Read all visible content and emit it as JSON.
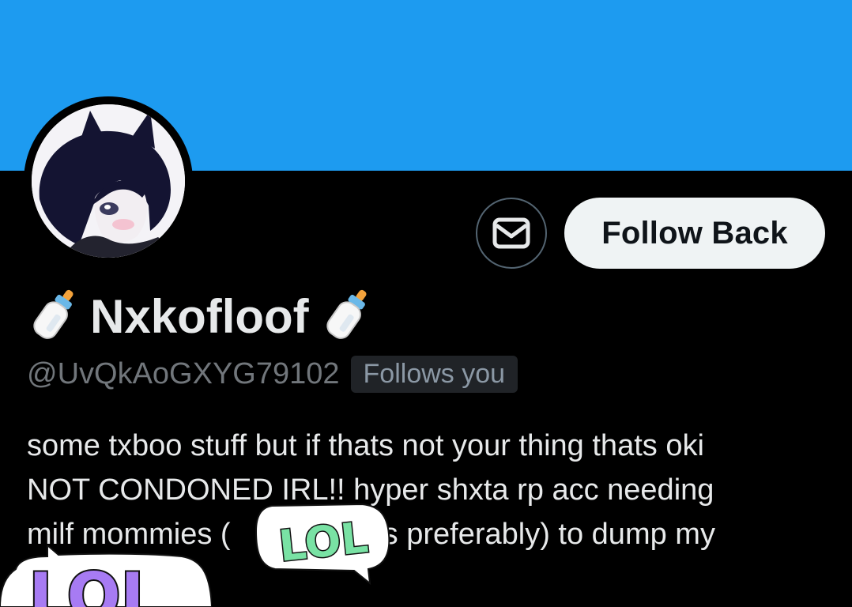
{
  "profile": {
    "display_name": "Nxkofloof",
    "handle": "@UvQkAoGXYG79102",
    "follows_you_badge": "Follows you",
    "name_emoji": "baby-bottle-icon"
  },
  "actions": {
    "message_icon": "mail-icon",
    "follow_back_label": "Follow Back"
  },
  "bio": {
    "lines": [
      "some txboo stuff but if thats not your thing thats oki",
      "NOT CONDONED IRL!!  hyper shxta rp acc needing",
      "milf mommies (",
      "es preferably) to dump my"
    ]
  },
  "stickers": {
    "lol_1": "LOL",
    "lol_2": "LOL"
  },
  "colors": {
    "banner": "#1d9bf0",
    "background": "#000000",
    "text_primary": "#e7e9ea",
    "text_secondary": "#71767b",
    "follow_button_bg": "#eff3f4",
    "sticker_purple": "#a77bf3",
    "sticker_green": "#79e2a4"
  }
}
